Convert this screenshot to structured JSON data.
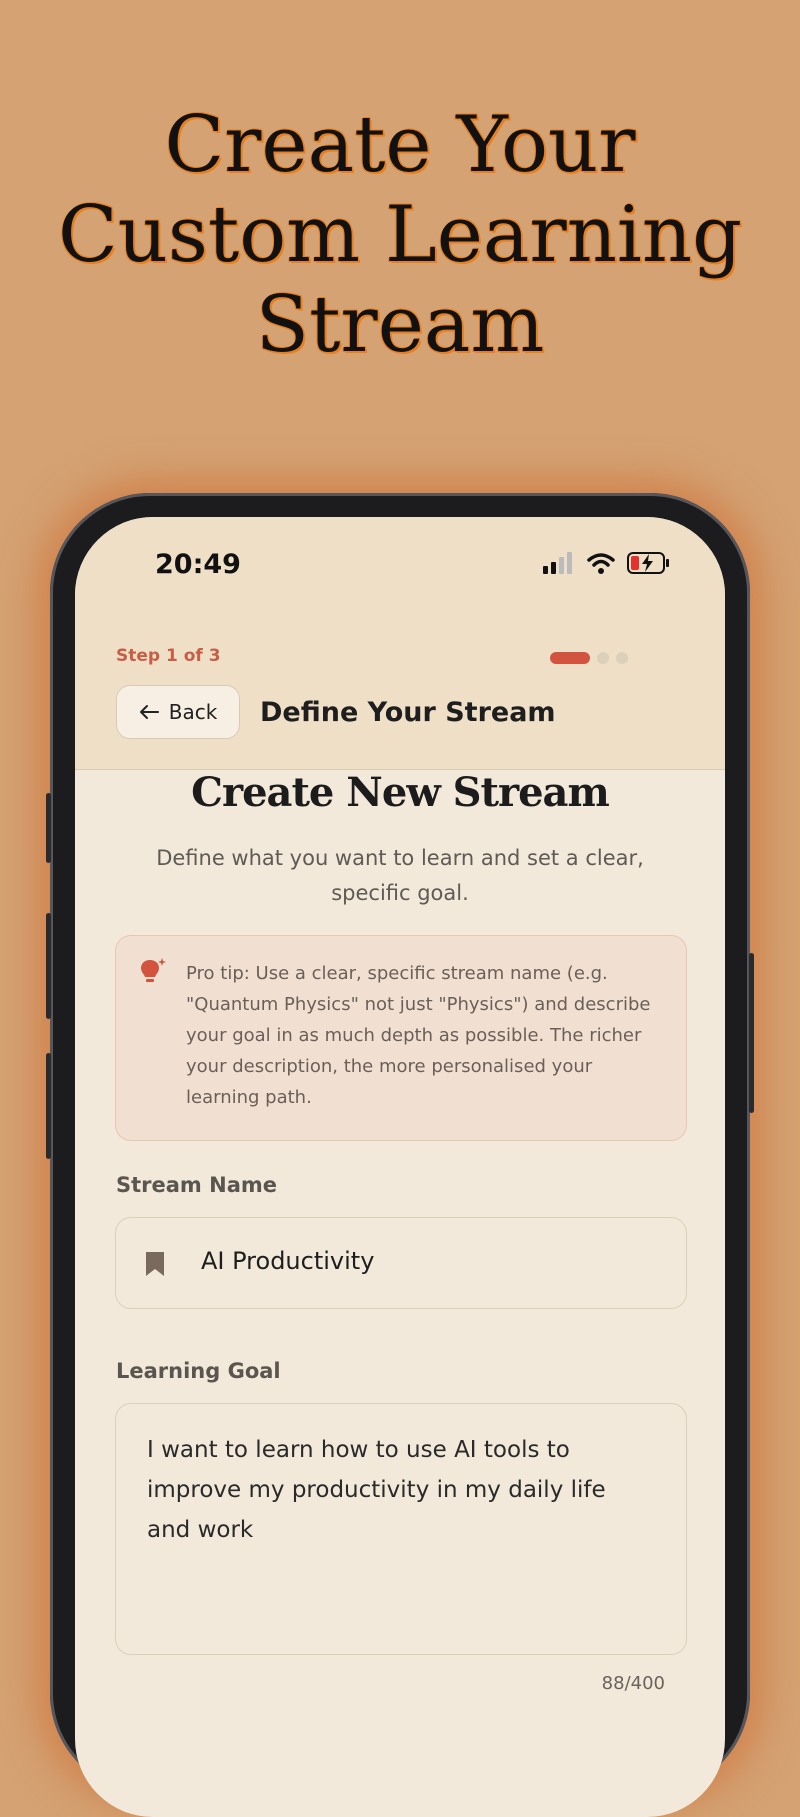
{
  "headline": {
    "line1": "Create Your",
    "line2": "Custom Learning",
    "line3": "Stream"
  },
  "status_bar": {
    "time": "20:49",
    "icons": [
      "signal-icon",
      "wifi-icon",
      "battery-charging-icon"
    ]
  },
  "header": {
    "step_label": "Step 1 of 3",
    "step_current": 1,
    "step_total": 3,
    "back_label": "Back",
    "title": "Define Your Stream"
  },
  "main": {
    "title": "Create New Stream",
    "subtitle": "Define what you want to learn and set a clear, specific goal.",
    "tip": "Pro tip: Use a clear, specific stream name (e.g. \"Quantum Physics\" not just \"Physics\") and describe your goal in as much depth as possible. The richer your description, the more personalised your learning path."
  },
  "form": {
    "stream_name_label": "Stream Name",
    "stream_name_value": "AI Productivity",
    "learning_goal_label": "Learning Goal",
    "learning_goal_value": "I want to learn how to use AI tools to improve my productivity in my daily life and work",
    "char_count": "88/400"
  },
  "colors": {
    "background": "#d4a273",
    "accent": "#d2543e",
    "header_bg": "#eedfc6",
    "screen_bg": "#f2e9da",
    "tip_bg": "#f1e0d2"
  }
}
